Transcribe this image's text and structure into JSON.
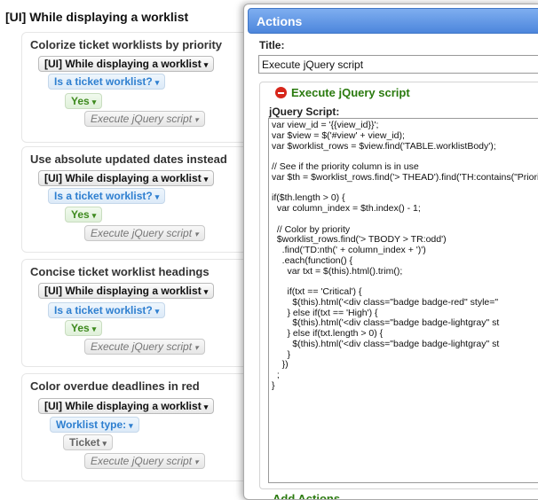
{
  "page": {
    "title": "[UI] While displaying a worklist"
  },
  "behaviors": [
    {
      "name": "Colorize ticket worklists by priority",
      "event": "[UI] While displaying a worklist",
      "condition": "Is a ticket worklist?",
      "outcome": "Yes",
      "action": "Execute jQuery script"
    },
    {
      "name": "Use absolute updated dates instead",
      "event": "[UI] While displaying a worklist",
      "condition": "Is a ticket worklist?",
      "outcome": "Yes",
      "action": "Execute jQuery script"
    },
    {
      "name": "Concise ticket worklist headings",
      "event": "[UI] While displaying a worklist",
      "condition": "Is a ticket worklist?",
      "outcome": "Yes",
      "action": "Execute jQuery script"
    },
    {
      "name": "Color overdue deadlines in red",
      "event": "[UI] While displaying a worklist",
      "condition": "Worklist type:",
      "outcome": "Ticket",
      "action": "Execute jQuery script"
    }
  ],
  "popup": {
    "header": "Actions",
    "title_label": "Title:",
    "title_value": "Execute jQuery script",
    "section_title": "Execute jQuery script",
    "script_label": "jQuery Script:",
    "script": "var view_id = '{{view_id}}';\nvar $view = $('#view' + view_id);\nvar $worklist_rows = $view.find('TABLE.worklistBody');\n\n// See if the priority column is in use\nvar $th = $worklist_rows.find('> THEAD').find('TH:contains(\"Priority\")');\n\nif($th.length > 0) {\n  var column_index = $th.index() - 1;\n\n  // Color by priority\n  $worklist_rows.find('> TBODY > TR:odd')\n    .find('TD:nth(' + column_index + ')')\n    .each(function() {\n      var txt = $(this).html().trim();\n\n      if(txt == 'Critical') {\n        $(this).html('<div class=\"badge badge-red\" style=\"\n      } else if(txt == 'High') {\n        $(this).html('<div class=\"badge badge-lightgray\" st\n      } else if(txt.length > 0) {\n        $(this).html('<div class=\"badge badge-lightgray\" st\n      }\n    })\n  ;\n}",
    "add_actions": "Add Actions"
  },
  "colors": {
    "header_blue": "#4d86dc",
    "condition_blue": "#2e7fd0",
    "outcome_green": "#3e8a1e",
    "section_green": "#2a7a0e",
    "remove_red": "#d7261b"
  },
  "icons": {
    "remove": "minus-circle-icon",
    "dropdown": "caret-down-icon"
  }
}
